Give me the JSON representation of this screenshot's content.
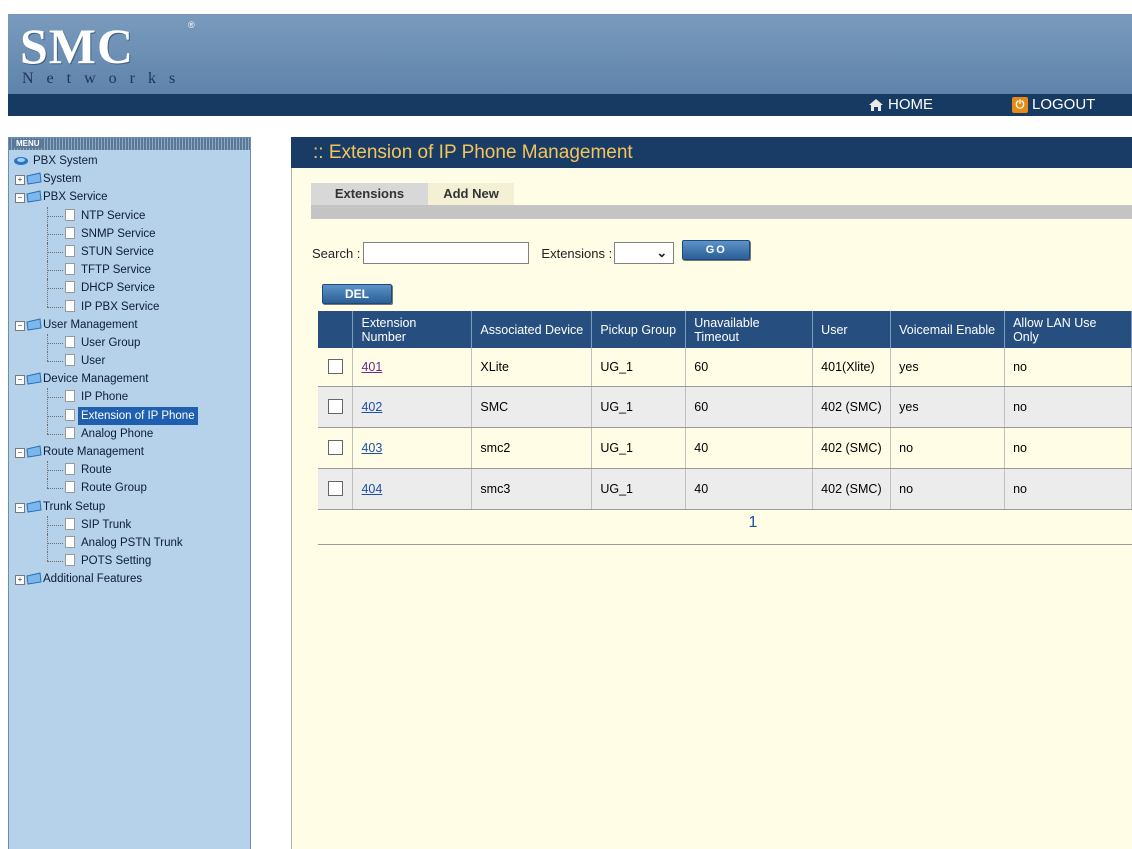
{
  "header": {
    "logo_main": "SMC",
    "logo_sub": "Networks",
    "logo_reg": "®",
    "home_label": "HOME",
    "logout_label": "LOGOUT"
  },
  "sidebar": {
    "menu_label": "MENU",
    "root": "PBX System",
    "items": {
      "system": "System",
      "pbx_service": "PBX Service",
      "ntp": "NTP Service",
      "snmp": "SNMP Service",
      "stun": "STUN Service",
      "tftp": "TFTP Service",
      "dhcp": "DHCP Service",
      "ippbx": "IP PBX Service",
      "user_mgmt": "User Management",
      "user_group": "User Group",
      "user": "User",
      "device_mgmt": "Device Management",
      "ip_phone": "IP Phone",
      "ext_ip_phone": "Extension of IP Phone",
      "analog_phone": "Analog Phone",
      "route_mgmt": "Route Management",
      "route": "Route",
      "route_group": "Route Group",
      "trunk_setup": "Trunk Setup",
      "sip_trunk": "SIP Trunk",
      "analog_pstn": "Analog PSTN Trunk",
      "pots": "POTS Setting",
      "additional": "Additional Features"
    }
  },
  "main": {
    "title": ":: Extension of IP Phone Management",
    "tabs": {
      "extensions": "Extensions",
      "add_new": "Add New"
    },
    "search_label": "Search :",
    "search_value": "",
    "extensions_label": "Extensions :",
    "extensions_value": "",
    "go_label": "GO",
    "del_label": "DEL",
    "columns": {
      "c1": "Extension Number",
      "c2": "Associated Device",
      "c3": "Pickup Group",
      "c4": "Unavailable Timeout",
      "c5": "User",
      "c6": "Voicemail Enable",
      "c7": "Allow LAN Use Only"
    },
    "rows": [
      {
        "ext": "401",
        "device": "XLite",
        "group": "UG_1",
        "timeout": "60",
        "user": "401(Xlite)",
        "voicemail": "yes",
        "lan": "no"
      },
      {
        "ext": "402",
        "device": "SMC",
        "group": "UG_1",
        "timeout": "60",
        "user": "402 (SMC)",
        "voicemail": "yes",
        "lan": "no"
      },
      {
        "ext": "403",
        "device": "smc2",
        "group": "UG_1",
        "timeout": "40",
        "user": "402 (SMC)",
        "voicemail": "no",
        "lan": "no"
      },
      {
        "ext": "404",
        "device": "smc3",
        "group": "UG_1",
        "timeout": "40",
        "user": "402 (SMC)",
        "voicemail": "no",
        "lan": "no"
      }
    ],
    "page": "1"
  }
}
